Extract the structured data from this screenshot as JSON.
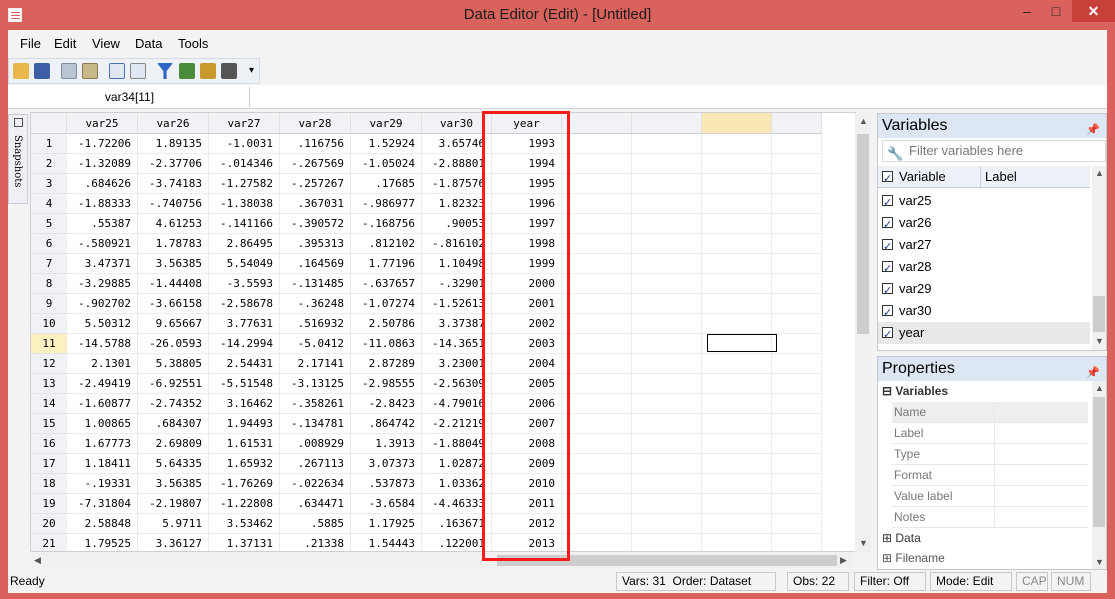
{
  "window": {
    "title": "Data Editor (Edit) - [Untitled]",
    "min": "–",
    "max": "□",
    "close": "✕"
  },
  "menu": [
    "File",
    "Edit",
    "View",
    "Data",
    "Tools"
  ],
  "toolbar_icons": [
    "open-icon",
    "save-icon",
    "copy-icon",
    "paste-icon",
    "edit-mode-icon",
    "browse-mode-icon",
    "filter-icon",
    "variables-manager-icon",
    "properties-icon",
    "snapshot-icon"
  ],
  "cell_name": "var34[11]",
  "snapshots_label": "Snapshots",
  "grid": {
    "columns": [
      "var25",
      "var26",
      "var27",
      "var28",
      "var29",
      "var30",
      "year"
    ],
    "active_row": 11,
    "rows": [
      [
        "1",
        "-1.72206",
        "1.89135",
        "-1.0031",
        ".116756",
        "1.52924",
        "3.65746",
        "1993"
      ],
      [
        "2",
        "-1.32089",
        "-2.37706",
        "-.014346",
        "-.267569",
        "-1.05024",
        "-2.88801",
        "1994"
      ],
      [
        "3",
        ".684626",
        "-3.74183",
        "-1.27582",
        "-.257267",
        ".17685",
        "-1.87576",
        "1995"
      ],
      [
        "4",
        "-1.88333",
        "-.740756",
        "-1.38038",
        ".367031",
        "-.986977",
        "1.82323",
        "1996"
      ],
      [
        "5",
        ".55387",
        "4.61253",
        "-.141166",
        "-.390572",
        "-.168756",
        ".90053",
        "1997"
      ],
      [
        "6",
        "-.580921",
        "1.78783",
        "2.86495",
        ".395313",
        ".812102",
        "-.816102",
        "1998"
      ],
      [
        "7",
        "3.47371",
        "3.56385",
        "5.54049",
        ".164569",
        "1.77196",
        "1.10498",
        "1999"
      ],
      [
        "8",
        "-3.29885",
        "-1.44408",
        "-3.5593",
        "-.131485",
        "-.637657",
        "-.32901",
        "2000"
      ],
      [
        "9",
        "-.902702",
        "-3.66158",
        "-2.58678",
        "-.36248",
        "-1.07274",
        "-1.52613",
        "2001"
      ],
      [
        "10",
        "5.50312",
        "9.65667",
        "3.77631",
        ".516932",
        "2.50786",
        "3.37387",
        "2002"
      ],
      [
        "11",
        "-14.5788",
        "-26.0593",
        "-14.2994",
        "-5.0412",
        "-11.0863",
        "-14.3651",
        "2003"
      ],
      [
        "12",
        "2.1301",
        "5.38805",
        "2.54431",
        "2.17141",
        "2.87289",
        "3.23001",
        "2004"
      ],
      [
        "13",
        "-2.49419",
        "-6.92551",
        "-5.51548",
        "-3.13125",
        "-2.98555",
        "-2.56309",
        "2005"
      ],
      [
        "14",
        "-1.60877",
        "-2.74352",
        "3.16462",
        "-.358261",
        "-2.8423",
        "-4.79016",
        "2006"
      ],
      [
        "15",
        "1.00865",
        ".684307",
        "1.94493",
        "-.134781",
        ".864742",
        "-2.21219",
        "2007"
      ],
      [
        "16",
        "1.67773",
        "2.69809",
        "1.61531",
        ".008929",
        "1.3913",
        "-1.88049",
        "2008"
      ],
      [
        "17",
        "1.18411",
        "5.64335",
        "1.65932",
        ".267113",
        "3.07373",
        "1.02872",
        "2009"
      ],
      [
        "18",
        "-.19331",
        "3.56385",
        "-1.76269",
        "-.022634",
        ".537873",
        "1.03362",
        "2010"
      ],
      [
        "19",
        "-7.31804",
        "-2.19807",
        "-1.22808",
        ".634471",
        "-3.6584",
        "-4.46333",
        "2011"
      ],
      [
        "20",
        "2.58848",
        "5.9711",
        "3.53462",
        ".5885",
        "1.17925",
        ".163671",
        "2012"
      ],
      [
        "21",
        "1.79525",
        "3.36127",
        "1.37131",
        ".21338",
        "1.54443",
        ".122001",
        "2013"
      ]
    ]
  },
  "variables_pane": {
    "title": "Variables",
    "filter_placeholder": "Filter variables here",
    "col_variable": "Variable",
    "col_label": "Label",
    "items": [
      "var25",
      "var26",
      "var27",
      "var28",
      "var29",
      "var30",
      "year"
    ]
  },
  "properties_pane": {
    "title": "Properties",
    "group": "Variables",
    "fields": [
      "Name",
      "Label",
      "Type",
      "Format",
      "Value label",
      "Notes"
    ],
    "group2": "Data",
    "group2_field": "Filename"
  },
  "status": {
    "ready": "Ready",
    "vars": "Vars: 31",
    "order": "Order: Dataset",
    "obs": "Obs: 22",
    "filter": "Filter: Off",
    "mode": "Mode: Edit",
    "cap": "CAP",
    "num": "NUM"
  },
  "colors": {
    "title_bar": "#d9625c",
    "highlight_box": "#ff1a1a",
    "active_row": "#fdf0c0"
  }
}
